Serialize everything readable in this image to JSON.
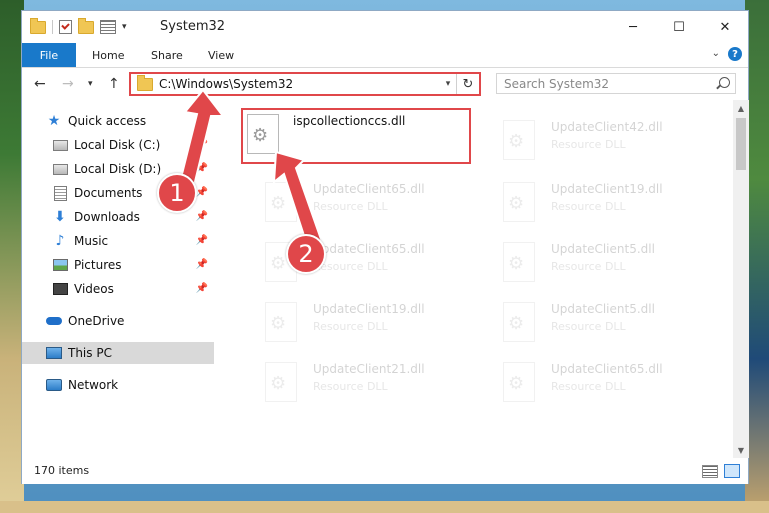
{
  "window": {
    "title": "System32",
    "minimize_glyph": "─",
    "maximize_glyph": "☐",
    "close_glyph": "✕",
    "qa_dropdown_glyph": "▾"
  },
  "ribbon": {
    "tabs": [
      "File",
      "Home",
      "Share",
      "View"
    ],
    "expand_glyph": "⌄",
    "help_glyph": "?"
  },
  "nav_buttons": {
    "back": "←",
    "forward": "→",
    "recent": "▾",
    "up": "↑"
  },
  "address": {
    "path": "C:\\Windows\\System32",
    "dropdown_glyph": "▾",
    "refresh_glyph": "↻"
  },
  "search": {
    "placeholder": "Search System32"
  },
  "nav_pane": {
    "quick_access": "Quick access",
    "items": [
      {
        "label": "Local Disk (C:)",
        "icon": "drive-icon",
        "pinned": true
      },
      {
        "label": "Local Disk (D:)",
        "icon": "drive-icon",
        "pinned": true
      },
      {
        "label": "Documents",
        "icon": "documents-icon",
        "pinned": true
      },
      {
        "label": "Downloads",
        "icon": "downloads-icon",
        "pinned": true
      },
      {
        "label": "Music",
        "icon": "music-icon",
        "pinned": true
      },
      {
        "label": "Pictures",
        "icon": "pictures-icon",
        "pinned": true
      },
      {
        "label": "Videos",
        "icon": "videos-icon",
        "pinned": true
      }
    ],
    "onedrive": "OneDrive",
    "this_pc": "This PC",
    "network": "Network",
    "pin_glyph": "📌",
    "star_glyph": "★",
    "download_glyph": "⬇",
    "music_glyph": "♪"
  },
  "files": [
    {
      "name": "ispcollectionccs.dll",
      "type": "",
      "highlighted": true
    },
    {
      "name": "UpdateClient42.dll",
      "type": "Resource DLL",
      "highlighted": false
    },
    {
      "name": "UpdateClient65.dll",
      "type": "Resource DLL",
      "highlighted": false
    },
    {
      "name": "UpdateClient19.dll",
      "type": "Resource DLL",
      "highlighted": false
    },
    {
      "name": "UpdateClient65.dll",
      "type": "Resource DLL",
      "highlighted": false
    },
    {
      "name": "UpdateClient5.dll",
      "type": "Resource DLL",
      "highlighted": false
    },
    {
      "name": "UpdateClient19.dll",
      "type": "Resource DLL",
      "highlighted": false
    },
    {
      "name": "UpdateClient5.dll",
      "type": "Resource DLL",
      "highlighted": false
    },
    {
      "name": "UpdateClient21.dll",
      "type": "Resource DLL",
      "highlighted": false
    },
    {
      "name": "UpdateClient65.dll",
      "type": "Resource DLL",
      "highlighted": false
    }
  ],
  "scrollbar": {
    "up_glyph": "▲",
    "down_glyph": "▼"
  },
  "status": {
    "item_count": "170 items"
  },
  "annotations": {
    "step1": "1",
    "step2": "2",
    "color": "#e0474a"
  }
}
